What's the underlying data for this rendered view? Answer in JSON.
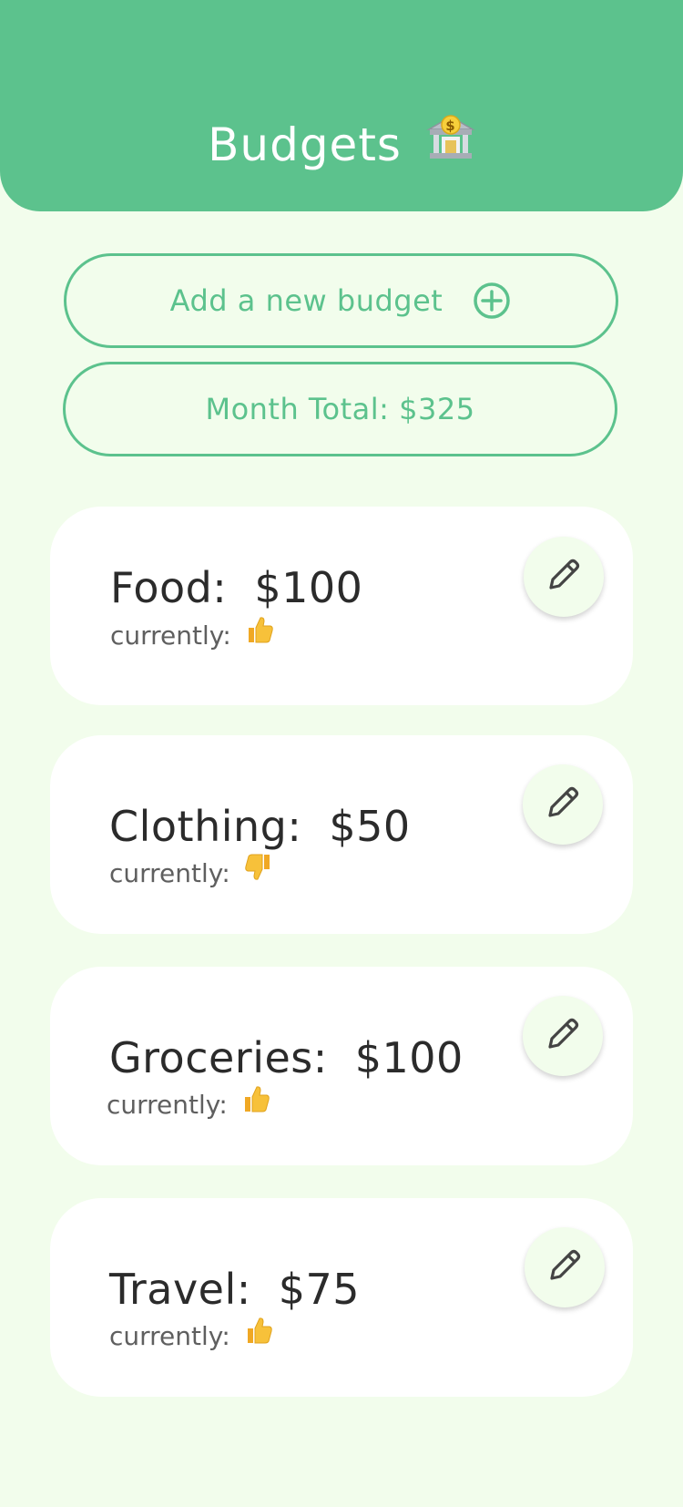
{
  "header": {
    "title": "Budgets",
    "title_emoji": "bank-icon"
  },
  "actions": {
    "add_label": "Add a new budget",
    "add_icon": "plus-circle-icon",
    "month_total": "Month Total: $325"
  },
  "budgets": [
    {
      "name": "Food:",
      "amount": "$100",
      "status_label": "currently:",
      "status_icon": "thumbs-up-icon"
    },
    {
      "name": "Clothing:",
      "amount": "$50",
      "status_label": "currently:",
      "status_icon": "thumbs-down-icon"
    },
    {
      "name": "Groceries:",
      "amount": "$100",
      "status_label": "currently:",
      "status_icon": "thumbs-up-icon"
    },
    {
      "name": "Travel:",
      "amount": "$75",
      "status_label": "currently:",
      "status_icon": "thumbs-up-icon"
    }
  ],
  "colors": {
    "brand": "#5cc28d",
    "background": "#f2fdec",
    "card": "#ffffff",
    "emoji": "#f7b731"
  }
}
